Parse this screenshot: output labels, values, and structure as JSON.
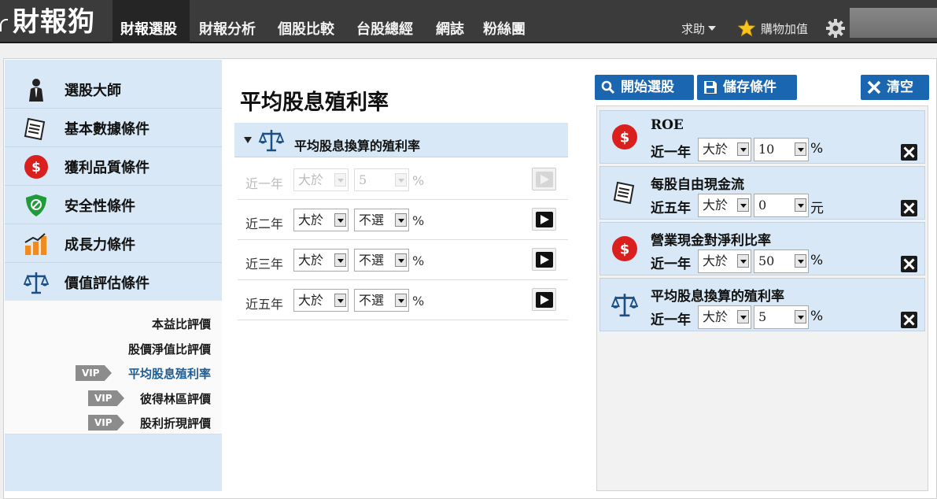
{
  "brand": {
    "name": "財報狗"
  },
  "nav": {
    "items": [
      "財報選股",
      "財報分析",
      "個股比較",
      "台股總經",
      "網誌",
      "粉絲團"
    ],
    "active_index": 0,
    "help_label": "求助",
    "buy_label": "購物加值"
  },
  "sidebar": {
    "items": [
      {
        "label": "選股大師",
        "icon": "businessman-icon"
      },
      {
        "label": "基本數據條件",
        "icon": "document-icon"
      },
      {
        "label": "獲利品質條件",
        "icon": "dollar-icon"
      },
      {
        "label": "安全性條件",
        "icon": "shield-icon"
      },
      {
        "label": "成長力條件",
        "icon": "bar-chart-icon"
      },
      {
        "label": "價值評估條件",
        "icon": "scale-icon"
      }
    ],
    "sub_items": [
      {
        "label": "本益比評價",
        "vip": false
      },
      {
        "label": "股價淨值比評價",
        "vip": false
      },
      {
        "label": "平均股息殖利率",
        "vip": true,
        "current": true
      },
      {
        "label": "彼得林區評價",
        "vip": true
      },
      {
        "label": "股利折現評價",
        "vip": true
      }
    ],
    "vip_label": "VIP"
  },
  "main": {
    "title": "平均股息殖利率",
    "section_label": "平均股息換算的殖利率",
    "unit": "%",
    "rows": [
      {
        "period": "近一年",
        "op": "大於",
        "value": "5",
        "enabled": false
      },
      {
        "period": "近二年",
        "op": "大於",
        "value": "不選",
        "enabled": true
      },
      {
        "period": "近三年",
        "op": "大於",
        "value": "不選",
        "enabled": true
      },
      {
        "period": "近五年",
        "op": "大於",
        "value": "不選",
        "enabled": true
      }
    ]
  },
  "actions": {
    "start_label": "開始選股",
    "save_label": "儲存條件",
    "clear_label": "清空"
  },
  "selected_conditions": [
    {
      "title": "ROE",
      "period": "近一年",
      "op": "大於",
      "value": "10",
      "unit": "%",
      "icon": "dollar-icon"
    },
    {
      "title": "每股自由現金流",
      "period": "近五年",
      "op": "大於",
      "value": "0",
      "unit": "元",
      "icon": "document-icon"
    },
    {
      "title": "營業現金對淨利比率",
      "period": "近一年",
      "op": "大於",
      "value": "50",
      "unit": "%",
      "icon": "dollar-icon"
    },
    {
      "title": "平均股息換算的殖利率",
      "period": "近一年",
      "op": "大於",
      "value": "5",
      "unit": "%",
      "icon": "scale-icon"
    }
  ],
  "colors": {
    "nav_bg": "#3b3b3b",
    "panel_blue": "#d8e8f6",
    "button_blue": "#1a66b0",
    "dollar_red": "#d9201f",
    "shield_green": "#1f9b3a",
    "chart_orange": "#f08c1e",
    "link_current": "#1e5d94"
  }
}
